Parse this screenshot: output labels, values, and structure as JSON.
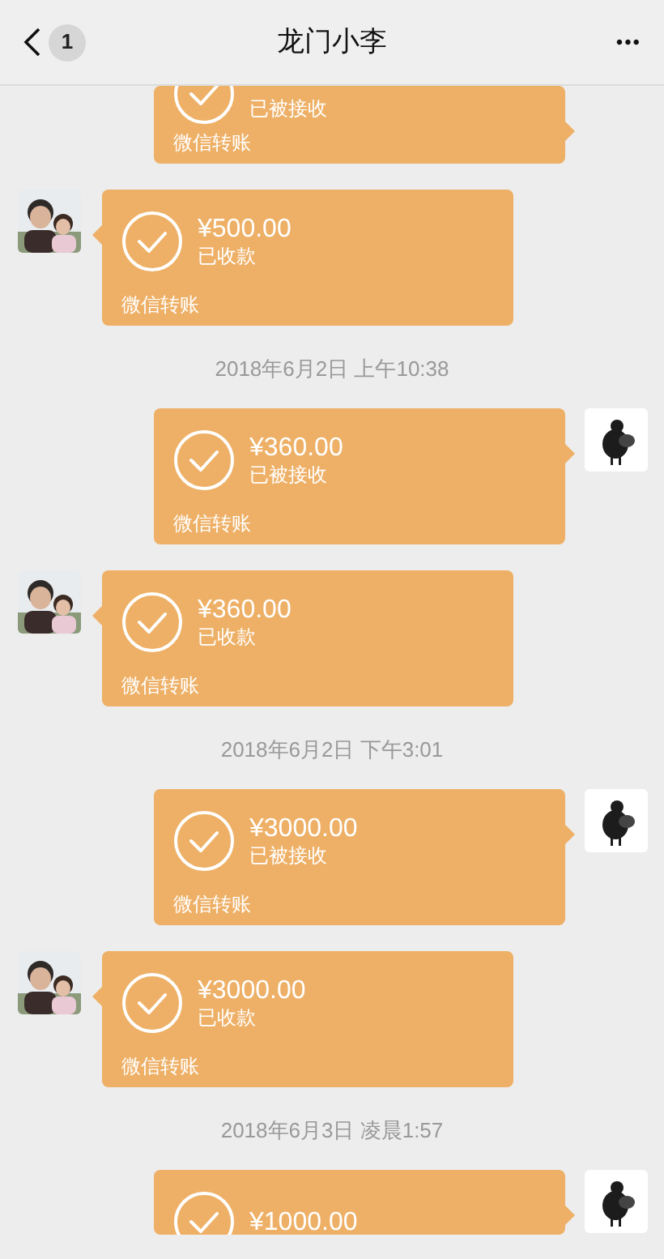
{
  "header": {
    "back_badge": "1",
    "title": "龙门小李",
    "more": "•••"
  },
  "messages": [
    {
      "kind": "sent",
      "status": "已被接收",
      "label": "微信转账"
    },
    {
      "kind": "received",
      "amount": "¥500.00",
      "status": "已收款",
      "label": "微信转账"
    },
    {
      "kind": "time",
      "text": "2018年6月2日 上午10:38"
    },
    {
      "kind": "sent",
      "amount": "¥360.00",
      "status": "已被接收",
      "label": "微信转账"
    },
    {
      "kind": "received",
      "amount": "¥360.00",
      "status": "已收款",
      "label": "微信转账"
    },
    {
      "kind": "time",
      "text": "2018年6月2日 下午3:01"
    },
    {
      "kind": "sent",
      "amount": "¥3000.00",
      "status": "已被接收",
      "label": "微信转账"
    },
    {
      "kind": "received",
      "amount": "¥3000.00",
      "status": "已收款",
      "label": "微信转账"
    },
    {
      "kind": "time",
      "text": "2018年6月3日 凌晨1:57"
    },
    {
      "kind": "sent",
      "amount": "¥1000.00"
    }
  ]
}
